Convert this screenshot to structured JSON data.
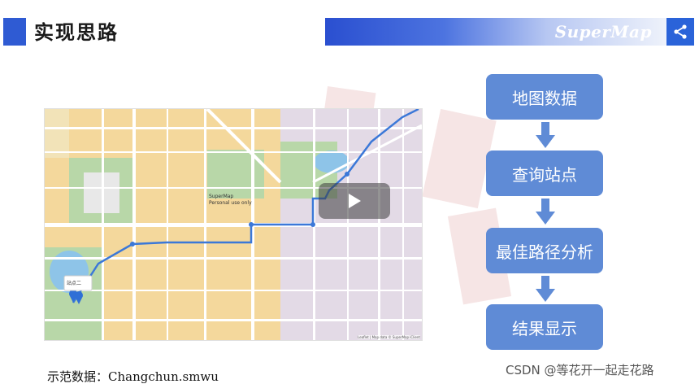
{
  "header": {
    "title": "实现思路",
    "brand": "SuperMap"
  },
  "map": {
    "watermark": "SuperMap\nPersonal use only",
    "popup": "站点二",
    "attribution": "Leaflet | Map data © SuperMap iClient"
  },
  "flow": {
    "steps": [
      "地图数据",
      "查询站点",
      "最佳路径分析",
      "结果显示"
    ]
  },
  "footer": {
    "demo_data": "示范数据：Changchun.smwu",
    "credit": "CSDN @等花开一起走花路"
  },
  "colors": {
    "accent": "#2f5bd3",
    "step": "#5f8bd6",
    "route": "#3b78d8"
  },
  "icons": {
    "share": "share-icon",
    "play": "play-icon",
    "arrow": "arrow-down-icon"
  }
}
